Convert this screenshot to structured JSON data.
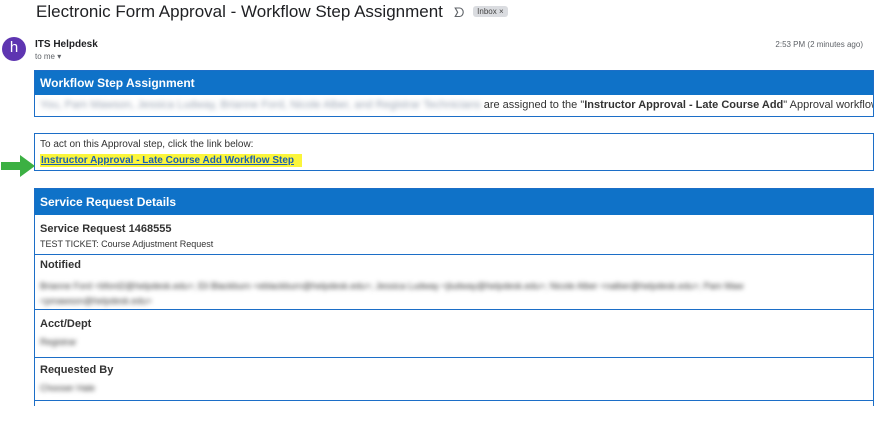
{
  "email": {
    "subject": "Electronic Form Approval - Workflow Step Assignment",
    "snooze_icon": "label-icon",
    "badge": "Inbox ×",
    "avatar_letter": "h",
    "sender": "ITS Helpdesk",
    "to": "to me ▾",
    "time": "2:53 PM (2 minutes ago)"
  },
  "assignment": {
    "title": "Workflow Step Assignment",
    "assignees_blurred": "You, Pam Mawson, Jessica Ludway, Brianne Ford, Nicole Alber, and Registrar Technicians",
    "text_pre": " are assigned to the \"",
    "step_name": "Instructor Approval - Late Course Add",
    "text_post": "\" Approval workflow step."
  },
  "action": {
    "instruction": "To act on this Approval step, click the link below:",
    "link_label": "Instructor Approval - Late Course Add Workflow Step"
  },
  "details": {
    "title": "Service Request Details",
    "request_label": "Service Request 1468555",
    "request_value": "TEST TICKET: Course Adjustment Request",
    "notified_label": "Notified",
    "notified_line1_blurred": "Brianne Ford <bford2@helpdesk.edu>; Eli Blackburn <eblackburn@helpdesk.edu>; Jessica Ludway <jludway@helpdesk.edu>; Nicole Alber <nalber@helpdesk.edu>; Pam Maw",
    "notified_line2_blurred": "<pmawson@helpdesk.edu>",
    "dept_label": "Acct/Dept",
    "dept_value_blurred": "Registrar",
    "requested_label": "Requested By",
    "requested_value_blurred": "Chooser Hale"
  },
  "colors": {
    "header_blue": "#0f72c8",
    "link_highlight": "#fbf53b",
    "arrow_green": "#3cb043"
  }
}
